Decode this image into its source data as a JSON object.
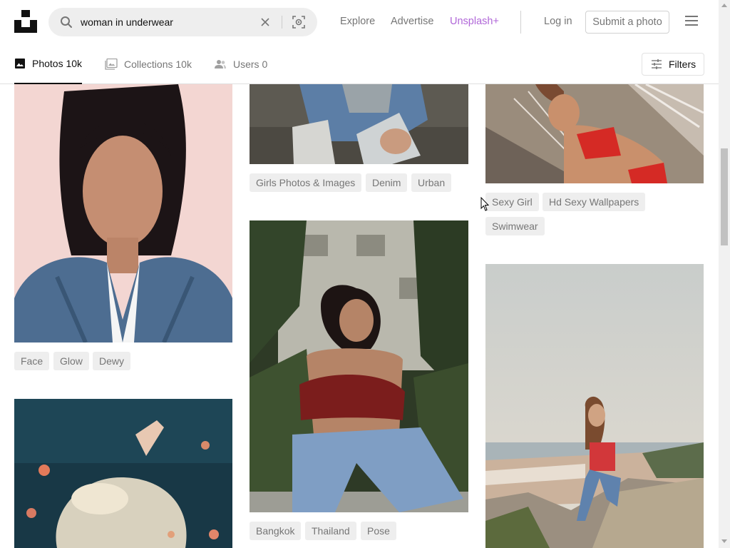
{
  "header": {
    "logo_icon": "unsplash-logo-icon",
    "search": {
      "value": "woman in underwear",
      "icons": [
        "search-icon",
        "clear-icon",
        "visual-search-icon"
      ]
    },
    "nav": {
      "explore": "Explore",
      "advertise": "Advertise",
      "unsplash_plus": "Unsplash+",
      "login": "Log in",
      "submit": "Submit a photo"
    },
    "menu_icon": "hamburger-menu-icon",
    "colors": {
      "plus": "#b066d8",
      "muted": "#767676"
    }
  },
  "tabs": {
    "photos": "Photos 10k",
    "collections": "Collections 10k",
    "users": "Users 0",
    "filters": "Filters"
  },
  "gallery": {
    "col1": {
      "photo1": {
        "description": "woman with dark hair in denim jacket on pink background",
        "tags": [
          "Face",
          "Glow",
          "Dewy"
        ]
      },
      "photo2": {
        "description": "woman in white dress floating in dark water with flowers"
      }
    },
    "col2": {
      "photo1": {
        "description": "person in denim jacket and ripped jeans crouching",
        "tags": [
          "Girls Photos & Images",
          "Denim",
          "Urban"
        ]
      },
      "photo2": {
        "description": "woman in red top and jeans sitting among palm plants",
        "tags": [
          "Bangkok",
          "Thailand",
          "Pose"
        ]
      }
    },
    "col3": {
      "photo1": {
        "description": "woman in red bikini in a hammock",
        "tags": [
          "Sexy Girl",
          "Hd Sexy Wallpapers",
          "Swimwear"
        ]
      },
      "photo2": {
        "description": "woman in red top and jeans sitting on rocks above a coastal town"
      }
    }
  }
}
